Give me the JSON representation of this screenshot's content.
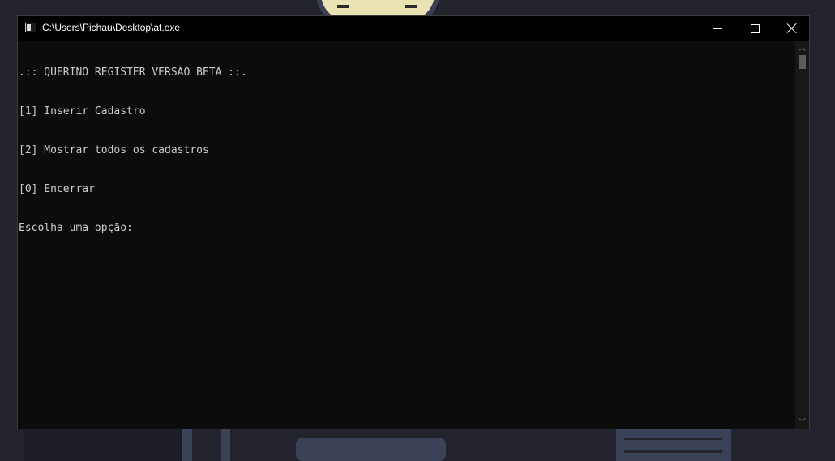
{
  "window": {
    "title": "C:\\Users\\Pichau\\Desktop\\at.exe",
    "controls": {
      "minimize_icon": "minimize-icon",
      "maximize_icon": "maximize-icon",
      "close_icon": "close-icon"
    }
  },
  "console": {
    "lines": [
      ".:: QUERINO REGISTER VERSÃO BETA ::.",
      "[1] Inserir Cadastro",
      "[2] Mostrar todos os cadastros",
      "[0] Encerrar",
      "Escolha uma opção:"
    ],
    "text_color": "#cccccc",
    "background_color": "#0c0c0c"
  },
  "scrollbar": {
    "up_glyph": "︿",
    "down_glyph": "﹀",
    "position": 0
  }
}
